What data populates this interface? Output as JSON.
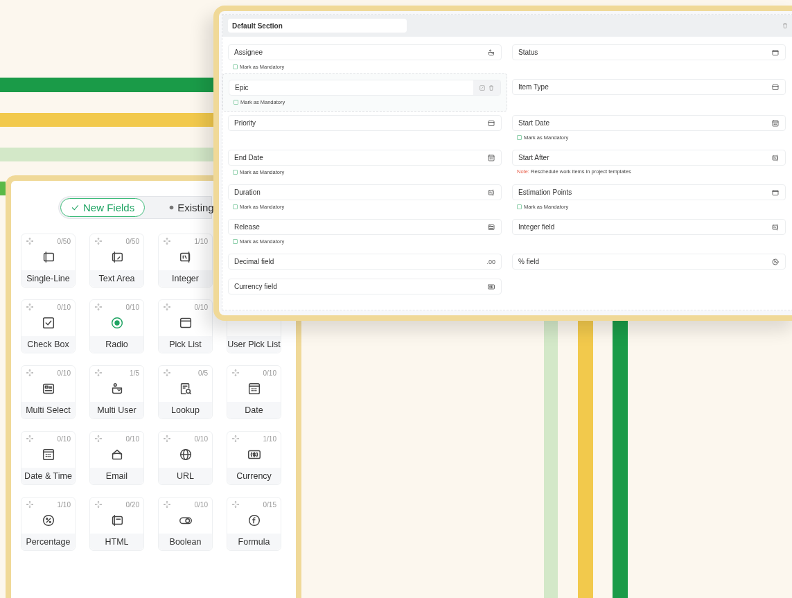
{
  "field_palette": {
    "tabs": [
      {
        "label": "New Fields",
        "selected": true
      },
      {
        "label": "Existing",
        "selected": false
      }
    ],
    "rows": [
      [
        {
          "label": "Single-Line",
          "count": "0/50",
          "kind": "single-line"
        },
        {
          "label": "Text Area",
          "count": "0/50",
          "kind": "text-area"
        },
        {
          "label": "Integer",
          "count": "1/10",
          "kind": "integer"
        }
      ],
      [
        {
          "label": "Check Box",
          "count": "0/10",
          "kind": "check-box"
        },
        {
          "label": "Radio",
          "count": "0/10",
          "kind": "radio"
        },
        {
          "label": "Pick List",
          "count": "0/10",
          "kind": "pick-list"
        },
        {
          "label": "User Pick List"
        }
      ],
      [
        {
          "label": "Multi Select",
          "count": "0/10",
          "kind": "multi-select"
        },
        {
          "label": "Multi User",
          "count": "1/5",
          "kind": "multi-user"
        },
        {
          "label": "Lookup",
          "count": "0/5",
          "kind": "lookup"
        },
        {
          "label": "Date",
          "count": "0/10",
          "kind": "date"
        }
      ],
      [
        {
          "label": "Date & Time",
          "count": "0/10",
          "kind": "date"
        },
        {
          "label": "Email",
          "count": "0/10",
          "kind": "email"
        },
        {
          "label": "URL",
          "count": "0/10",
          "kind": "url"
        },
        {
          "label": "Currency",
          "count": "1/10",
          "kind": "currency"
        }
      ],
      [
        {
          "label": "Percentage",
          "count": "1/10",
          "kind": "percentage"
        },
        {
          "label": "HTML",
          "count": "0/20",
          "kind": "html"
        },
        {
          "label": "Boolean",
          "count": "0/10",
          "kind": "boolean"
        },
        {
          "label": "Formula",
          "count": "0/15",
          "kind": "formula"
        }
      ]
    ]
  },
  "layout": {
    "section_title": "Default Section",
    "fields": [
      {
        "label": "Assignee",
        "kind": "multi-user",
        "hovered": false,
        "mandatory": {
          "label": "Mark as Mandatory",
          "checked": false
        }
      },
      {
        "label": "Status",
        "kind": "pick-list",
        "hovered": false
      },
      {
        "label": "Epic",
        "hovered": true,
        "mandatory": {
          "label": "Mark as Mandatory",
          "checked": false
        }
      },
      {
        "label": "Item Type",
        "kind": "pick-list",
        "hovered": false
      },
      {
        "label": "Priority",
        "kind": "pick-list",
        "hovered": false
      },
      {
        "label": "Start Date",
        "kind": "date",
        "hovered": false,
        "mandatory": {
          "label": "Mark as Mandatory",
          "checked": false
        }
      },
      {
        "label": "End Date",
        "kind": "date",
        "hovered": false,
        "mandatory": {
          "label": "Mark as Mandatory",
          "checked": false
        }
      },
      {
        "label": "Start After",
        "kind": "integer",
        "hovered": false,
        "note": {
          "label": "Note:",
          "text": "Reschedule work items in project templates"
        }
      },
      {
        "label": "Duration",
        "kind": "integer",
        "hovered": false,
        "mandatory": {
          "label": "Mark as Mandatory",
          "checked": false
        }
      },
      {
        "label": "Estimation Points",
        "kind": "pick-list",
        "hovered": false,
        "mandatory": {
          "label": "Mark as Mandatory",
          "checked": false
        }
      },
      {
        "label": "Release",
        "kind": "multi-select",
        "hovered": false,
        "mandatory": {
          "label": "Mark as Mandatory",
          "checked": false
        }
      },
      {
        "label": "Integer field",
        "kind": "integer",
        "hovered": false
      },
      {
        "label": "Decimal field",
        "kind": "text",
        "icon_text": ".00",
        "hovered": false
      },
      {
        "label": "% field",
        "kind": "percentage",
        "hovered": false
      },
      {
        "label": "Currency field",
        "kind": "currency",
        "hovered": false
      }
    ]
  }
}
